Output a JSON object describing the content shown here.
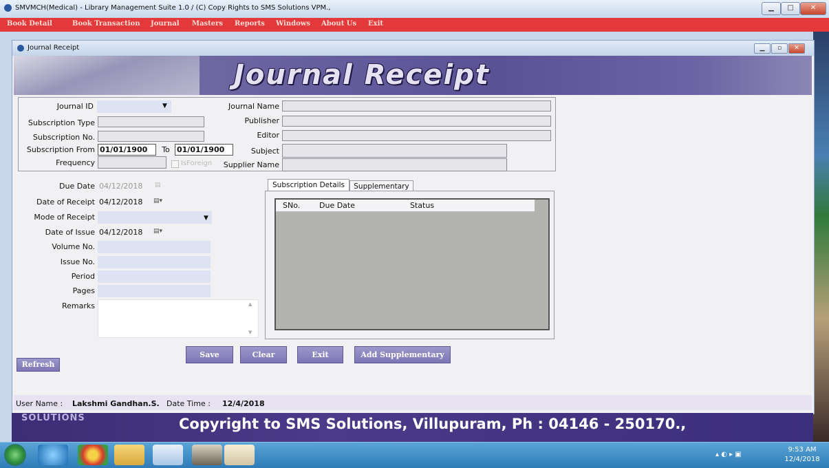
{
  "window": {
    "title": "SMVMCH(Medical) - Library Management Suite 1.0  / (C) Copy Rights to SMS Solutions VPM.,",
    "controls": {
      "minimize": "▁",
      "maximize": "□",
      "close": "✕"
    }
  },
  "menu": [
    "Book Detail",
    "Book Transaction",
    "Journal",
    "Masters",
    "Reports",
    "Windows",
    "About Us",
    "Exit"
  ],
  "child_window": {
    "title": "Journal Receipt",
    "controls": {
      "minimize": "▁",
      "restore": "▫",
      "close": "✕"
    }
  },
  "banner": {
    "title": "Journal Receipt"
  },
  "form": {
    "journal_id": {
      "label": "Journal ID",
      "value": ""
    },
    "journal_name": {
      "label": "Journal Name",
      "value": ""
    },
    "subscription_type": {
      "label": "Subscription Type",
      "value": ""
    },
    "publisher": {
      "label": "Publisher",
      "value": ""
    },
    "subscription_no": {
      "label": "Subscription No.",
      "value": ""
    },
    "editor": {
      "label": "Editor",
      "value": ""
    },
    "subscription_from": {
      "label": "Subscription From",
      "value": "01/01/1900"
    },
    "to": {
      "label": "To",
      "value": "01/01/1900"
    },
    "subject": {
      "label": "Subject",
      "value": ""
    },
    "frequency": {
      "label": "Frequency",
      "value": ""
    },
    "is_foreign": {
      "label": "IsForeign",
      "checked": false
    },
    "supplier_name": {
      "label": "Supplier Name",
      "value": ""
    },
    "due_date": {
      "label": "Due Date",
      "value": "04/12/2018"
    },
    "date_of_receipt": {
      "label": "Date of Receipt",
      "value": "04/12/2018"
    },
    "mode_of_receipt": {
      "label": "Mode of Receipt",
      "value": ""
    },
    "date_of_issue": {
      "label": "Date of Issue",
      "value": "04/12/2018"
    },
    "volume_no": {
      "label": "Volume No.",
      "value": ""
    },
    "issue_no": {
      "label": "Issue No.",
      "value": ""
    },
    "period": {
      "label": "Period",
      "value": ""
    },
    "pages": {
      "label": "Pages",
      "value": ""
    },
    "remarks": {
      "label": "Remarks",
      "value": ""
    }
  },
  "tabs": [
    {
      "label": "Subscription Details",
      "active": true
    },
    {
      "label": "Supplementary",
      "active": false
    }
  ],
  "grid": {
    "columns": [
      "SNo.",
      "Due Date",
      "Status"
    ],
    "rows": []
  },
  "buttons": {
    "save": "Save",
    "clear": "Clear",
    "exit": "Exit",
    "add_supplementary": "Add Supplementary",
    "refresh": "Refresh"
  },
  "status": {
    "user_label": "User Name :",
    "user_value": "Lakshmi Gandhan.S.",
    "datetime_label": "Date Time :",
    "datetime_value": "12/4/2018"
  },
  "copyright": {
    "logo_text": "SOLUTIONS",
    "text": "Copyright to SMS Solutions, Villupuram, Ph : 04146 - 250170.,"
  },
  "taskbar": {
    "items": [
      "start-orb",
      "ie-icon",
      "chrome-icon",
      "explorer-icon",
      "app-icon-1",
      "app-icon-2",
      "paint-icon"
    ],
    "time": "9:53 AM",
    "date": "12/4/2018"
  },
  "colors": {
    "menubar": "#e4393a",
    "banner": "#5a5295",
    "button": "#8d87c1"
  }
}
